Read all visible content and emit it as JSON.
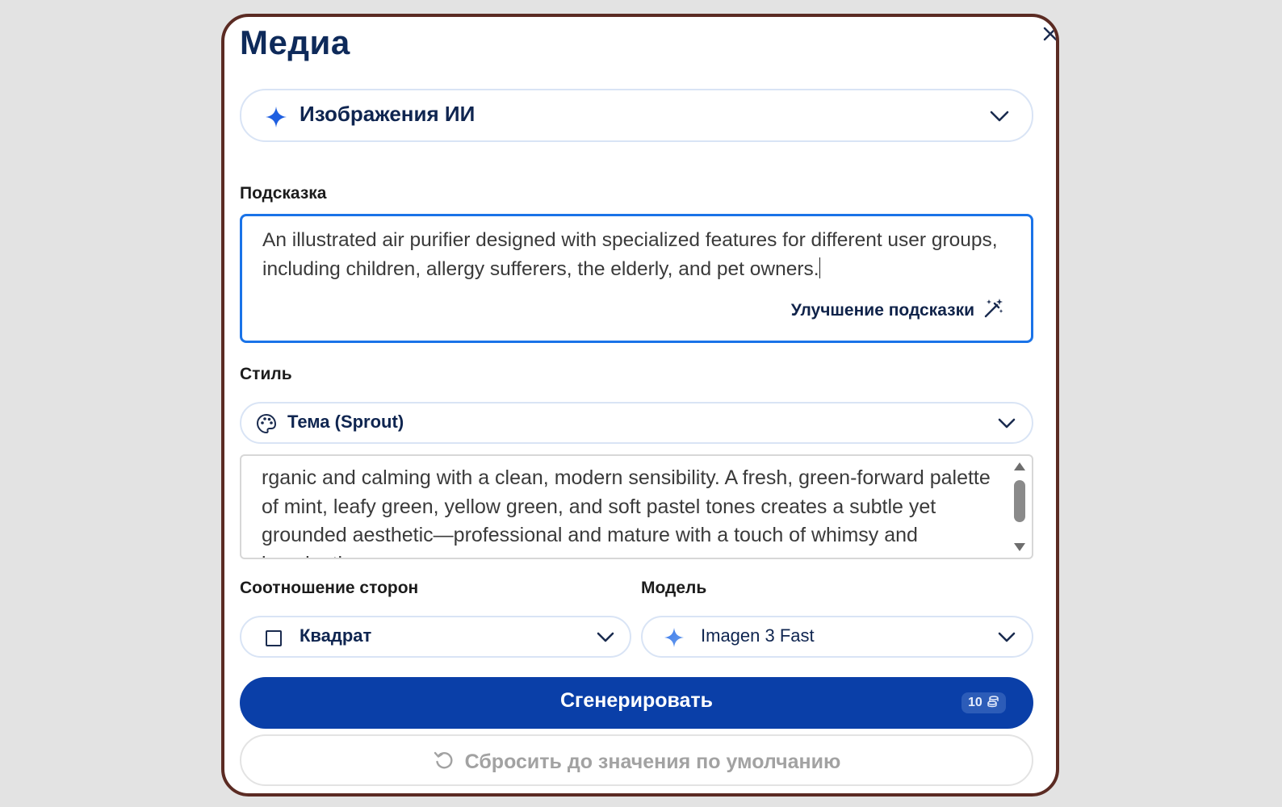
{
  "dialog": {
    "title": "Медиа",
    "close_icon": "close-icon"
  },
  "source": {
    "label": "Изображения ИИ",
    "icon": "sparkle-icon"
  },
  "prompt": {
    "label": "Подсказка",
    "value": "An illustrated air purifier designed with specialized features for different user groups, including children, allergy sufferers, the elderly, and pet owners.",
    "enhance_label": "Улучшение подсказки",
    "enhance_icon": "magic-wand-icon"
  },
  "style": {
    "label": "Стиль",
    "selected": "Тема (Sprout)",
    "icon": "palette-icon",
    "description": "rganic and calming with a clean, modern sensibility. A fresh, green-forward palette of mint, leafy green, yellow green, and soft pastel tones creates a subtle yet grounded aesthetic—professional and mature with a touch of whimsy and imagination."
  },
  "aspect_ratio": {
    "label": "Соотношение сторон",
    "selected": "Квадрат",
    "icon": "square-icon"
  },
  "model": {
    "label": "Модель",
    "selected": "Imagen 3 Fast",
    "icon": "sparkle-icon"
  },
  "actions": {
    "generate_label": "Сгенерировать",
    "credits": "10",
    "credits_icon": "coins-icon",
    "reset_label": "Сбросить до значения по умолчанию",
    "reset_icon": "reset-icon"
  },
  "colors": {
    "primary": "#0a3fa8",
    "focus_border": "#1a73e8",
    "heading": "#0e2a5a",
    "dialog_border": "#5b2b23"
  }
}
